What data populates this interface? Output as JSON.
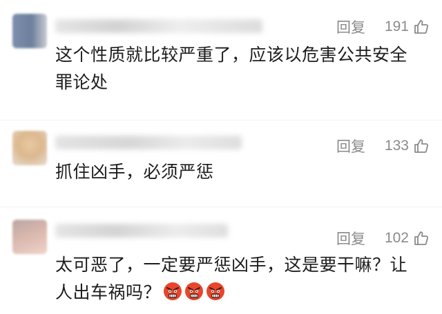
{
  "comments": [
    {
      "actions": {
        "reply_label": "回复",
        "like_count": "191"
      },
      "text_lines": [
        "这个性质就比较严重了，应该以危害公共安全",
        "罪论处"
      ],
      "emoji_count": 0
    },
    {
      "actions": {
        "reply_label": "回复",
        "like_count": "133"
      },
      "text_lines": [
        "抓住凶手，必须严惩"
      ],
      "emoji_count": 0
    },
    {
      "actions": {
        "reply_label": "回复",
        "like_count": "102"
      },
      "text_lines": [
        "太可恶了，一定要严惩凶手，这是要干嘛？让",
        "人出车祸吗？"
      ],
      "emoji_count": 3
    }
  ],
  "icons": {
    "like": "thumbs-up-outline-icon",
    "emoji": "angry-face-icon"
  },
  "colors": {
    "meta_text": "#8a8a8a",
    "body_text": "#1c1c1c",
    "emoji_red": "#e8452c"
  }
}
